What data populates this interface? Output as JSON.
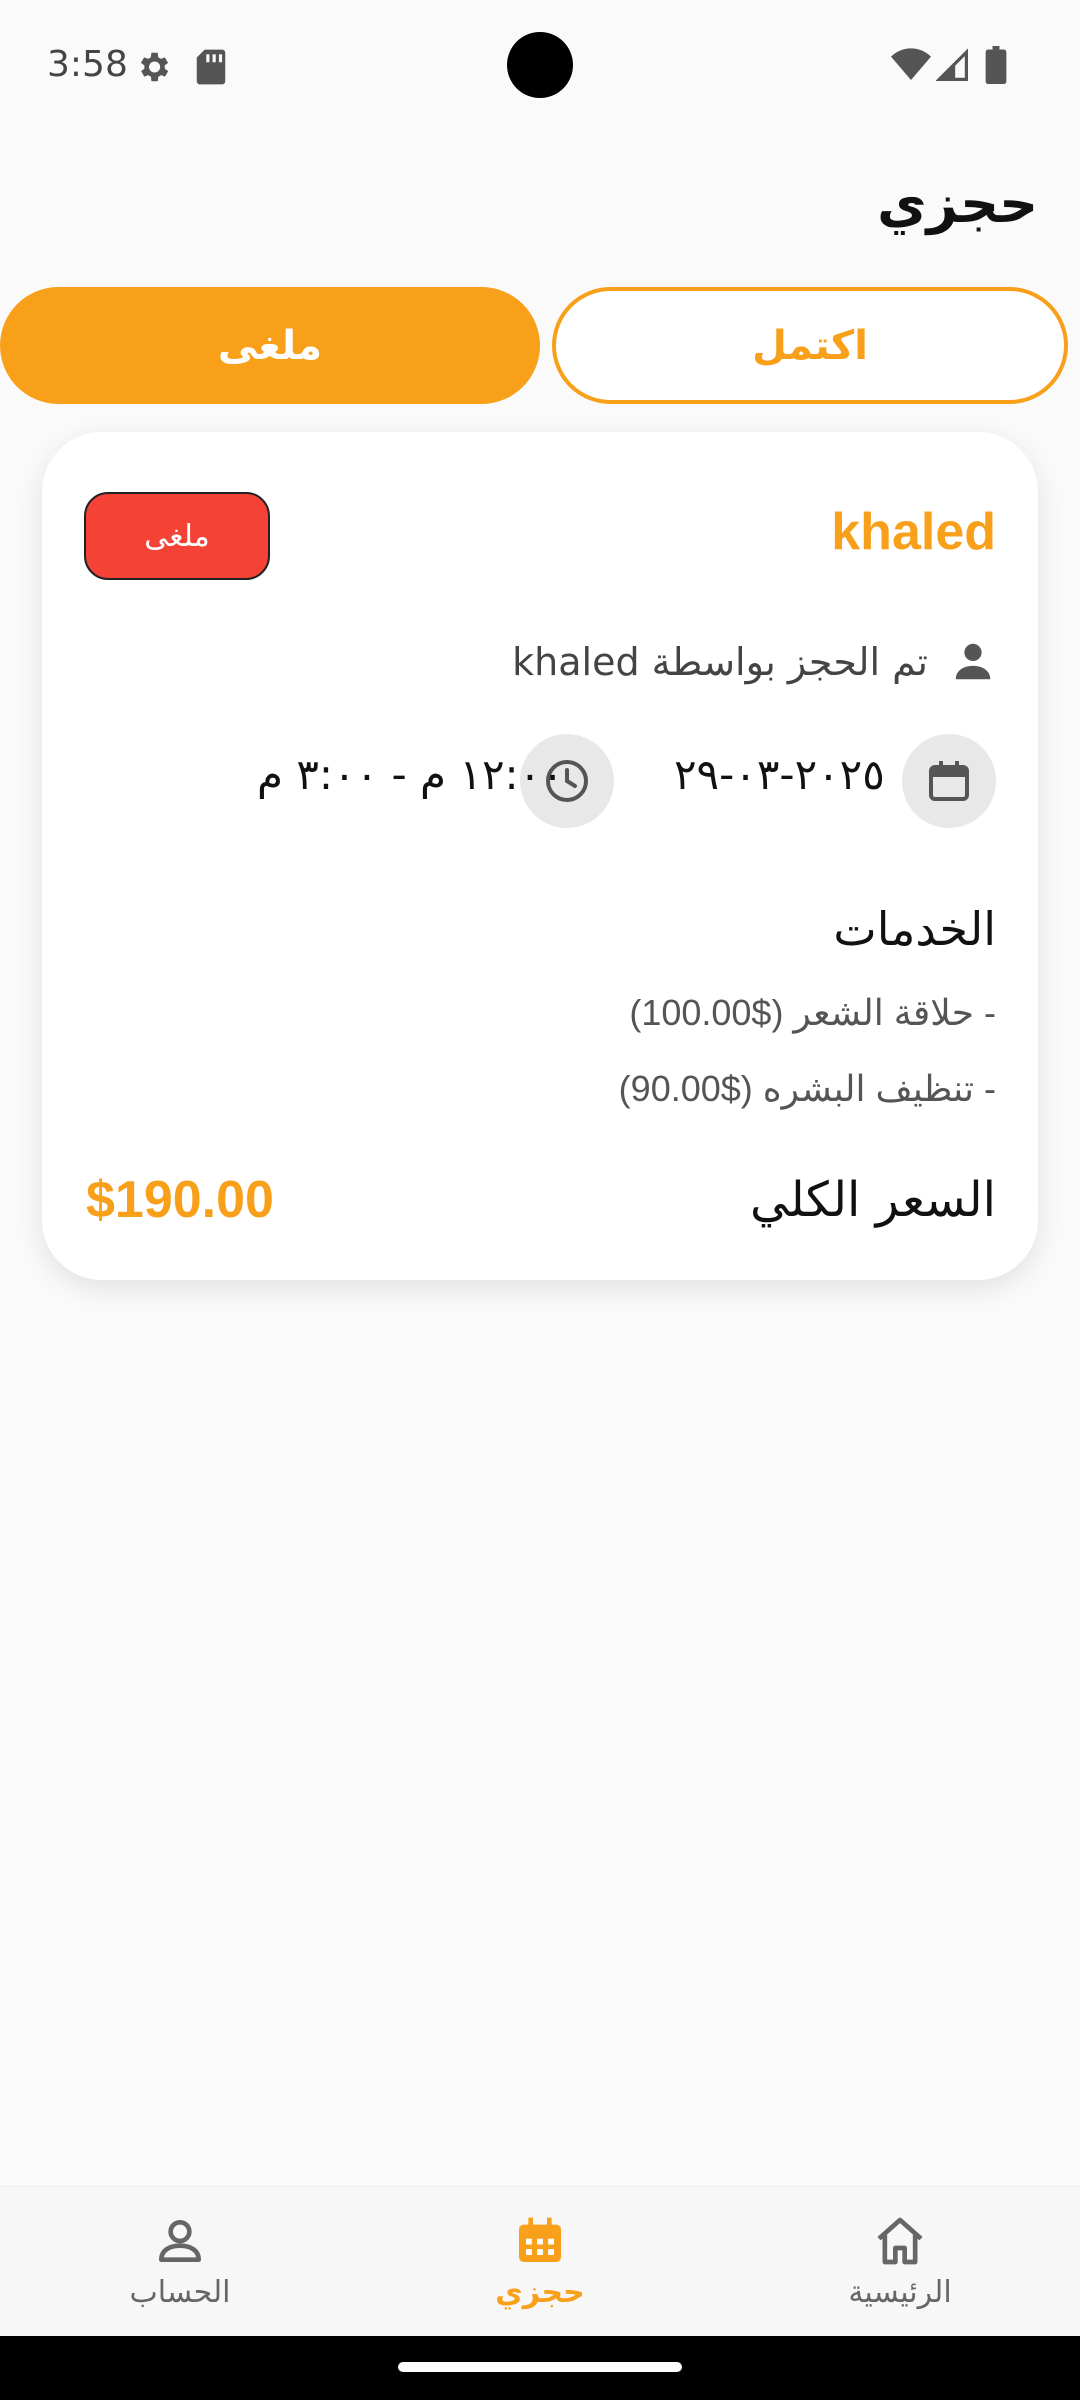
{
  "status_bar": {
    "time": "3:58",
    "icons": [
      "gear-icon",
      "sd-card-icon",
      "wifi-icon",
      "signal-icon",
      "battery-icon"
    ]
  },
  "page": {
    "title": "حجزي"
  },
  "tabs": {
    "completed_label": "اكتمل",
    "cancelled_label": "ملغى",
    "selected": "cancelled"
  },
  "booking": {
    "name": "khaled",
    "status": "ملغى",
    "booked_by": "تم الحجز بواسطة khaled",
    "date": "٢٠٢٥-٠٣-٢٩",
    "time": "١٢:٠٠ م - ٣:٠٠ م",
    "services_heading": "الخدمات",
    "services": [
      "- حلاقة الشعر  ($100.00)",
      "- تنظيف البشره  ($90.00)"
    ],
    "total_label": "السعر الكلي",
    "total_value": "$190.00"
  },
  "nav": {
    "home": "الرئيسية",
    "bookings": "حجزي",
    "account": "الحساب"
  },
  "colors": {
    "accent": "#f9a01b",
    "status_cancelled": "#f44336",
    "background": "#fafafa",
    "card": "#ffffff"
  }
}
